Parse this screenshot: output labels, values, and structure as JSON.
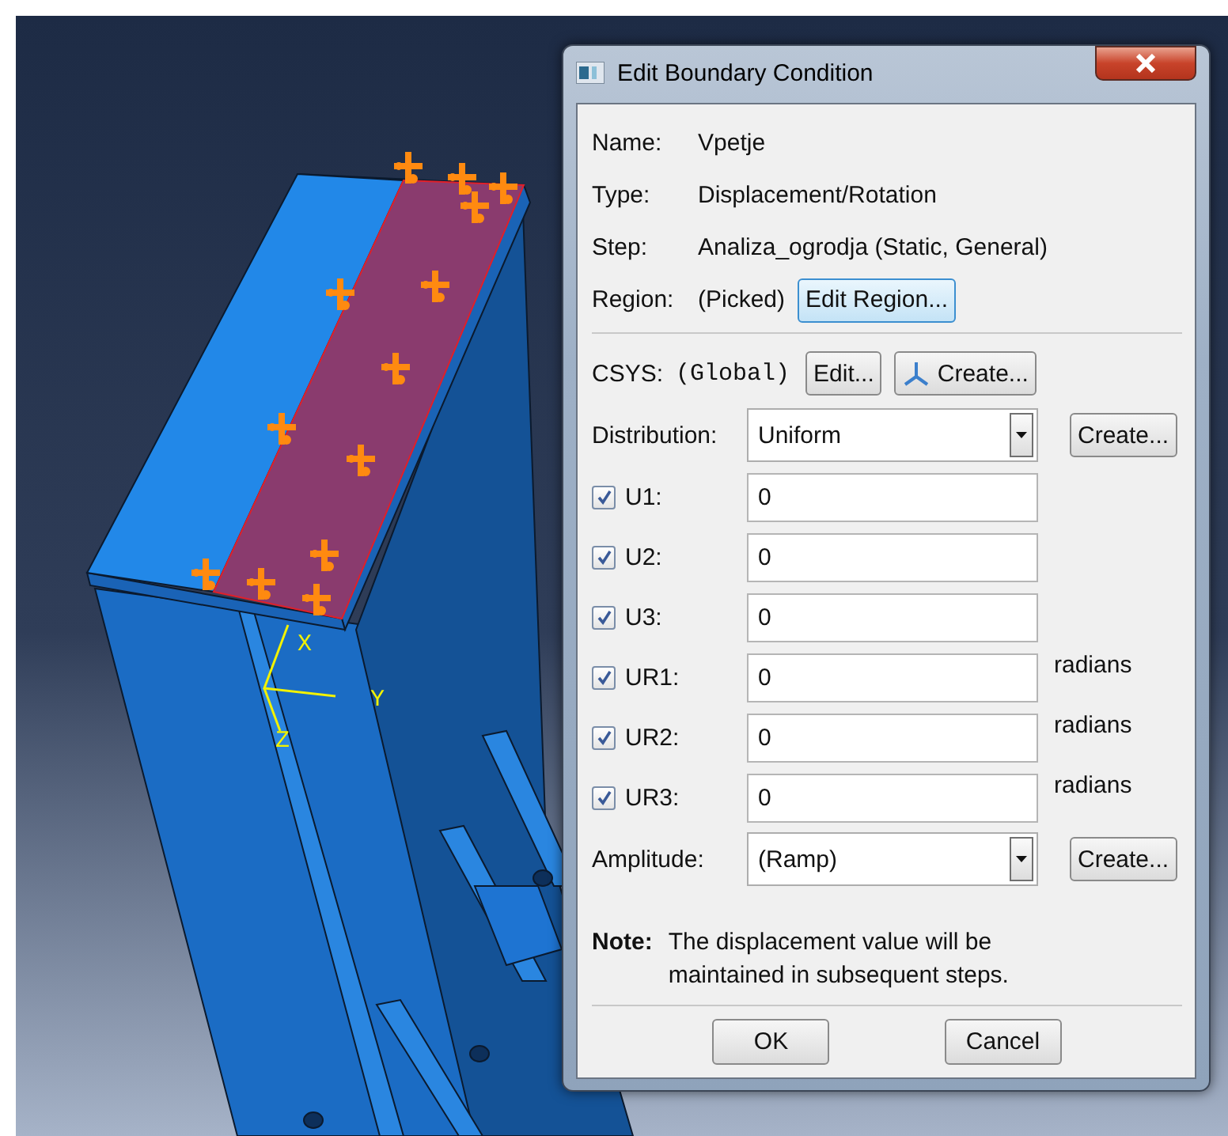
{
  "window": {
    "title": "Edit Boundary Condition"
  },
  "info": [
    {
      "label": "Name:",
      "value": "Vpetje"
    },
    {
      "label": "Type:",
      "value": "Displacement/Rotation"
    },
    {
      "label": "Step:",
      "value": "Analiza_ogrodja (Static, General)"
    }
  ],
  "region": {
    "label": "Region:",
    "value": "(Picked)",
    "button": "Edit Region..."
  },
  "csys": {
    "label": "CSYS:",
    "value": "(Global)",
    "buttons": [
      {
        "label": "Edit...",
        "kind": "plain"
      },
      {
        "label": "Create...",
        "kind": "triad"
      }
    ]
  },
  "distribution": {
    "label": "Distribution:",
    "value": "Uniform",
    "button": "Create..."
  },
  "dofs": [
    {
      "label": "U1:",
      "checked": true,
      "value": "0"
    },
    {
      "label": "U2:",
      "checked": true,
      "value": "0"
    },
    {
      "label": "U3:",
      "checked": true,
      "value": "0"
    },
    {
      "label": "UR1:",
      "checked": true,
      "value": "0",
      "unit": "radians"
    },
    {
      "label": "UR2:",
      "checked": true,
      "value": "0",
      "unit": "radians"
    },
    {
      "label": "UR3:",
      "checked": true,
      "value": "0",
      "unit": "radians"
    }
  ],
  "amplitude": {
    "label": "Amplitude:",
    "value": "(Ramp)",
    "button": "Create..."
  },
  "note": {
    "label": "Note:",
    "text": "The displacement value will be maintained in subsequent steps."
  },
  "buttons": [
    "OK",
    "Cancel"
  ],
  "viewport": {
    "axis_labels": [
      "X",
      "Y",
      "Z"
    ]
  }
}
